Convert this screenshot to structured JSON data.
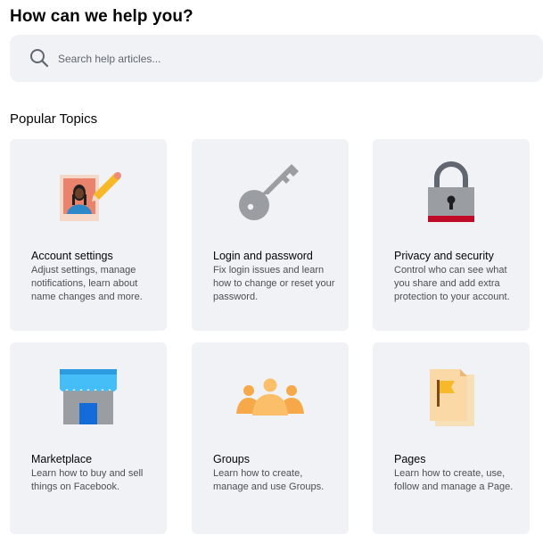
{
  "header": {
    "title": "How can we help you?"
  },
  "search": {
    "placeholder": "Search help articles...",
    "value": "",
    "icon": "search-icon"
  },
  "popular": {
    "title": "Popular Topics",
    "topics": [
      {
        "icon": "account-settings-illustration",
        "title": "Account settings",
        "description": "Adjust settings, manage notifications, learn about name changes and more."
      },
      {
        "icon": "key-illustration",
        "title": "Login and password",
        "description": "Fix login issues and learn how to change or reset your password."
      },
      {
        "icon": "padlock-illustration",
        "title": "Privacy and security",
        "description": "Control who can see what you share and add extra protection to your account."
      },
      {
        "icon": "storefront-illustration",
        "title": "Marketplace",
        "description": "Learn how to buy and sell things on Facebook."
      },
      {
        "icon": "people-group-illustration",
        "title": "Groups",
        "description": "Learn how to create, manage and use Groups."
      },
      {
        "icon": "page-flag-illustration",
        "title": "Pages",
        "description": "Learn how to create, use, follow and manage a Page."
      }
    ]
  },
  "colors": {
    "card_background": "#f0f2f5",
    "search_background": "#f0f2f5",
    "title_text": "#050505",
    "description_text": "#4b4f56"
  }
}
